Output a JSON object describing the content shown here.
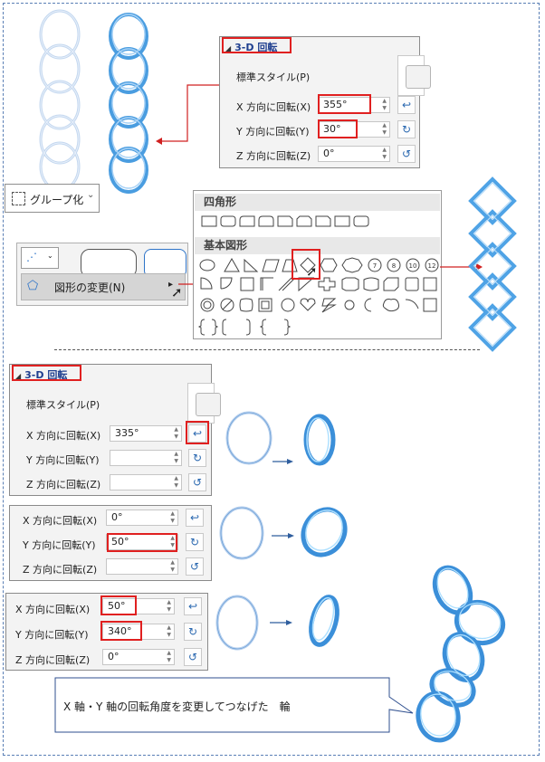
{
  "panel1": {
    "header": "3-D 回転",
    "preset_label": "標準スタイル(P)",
    "x_label": "X 方向に回転(X)",
    "x_value": "355°",
    "y_label": "Y 方向に回転(Y)",
    "y_value": "30°",
    "z_label": "Z 方向に回転(Z)",
    "z_value": "0°"
  },
  "group_button": {
    "label": "グループ化",
    "chevron": "⌄"
  },
  "shapes_gallery": {
    "section1": "四角形",
    "section2": "基本図形",
    "numbers": [
      "7",
      "8",
      "10",
      "12"
    ]
  },
  "menu": {
    "change_shape": "図形の変更(N)"
  },
  "panel2": {
    "header": "3-D 回転",
    "preset_label": "標準スタイル(P)",
    "x_label": "X 方向に回転(X)",
    "x_value": "335°",
    "y_label": "Y 方向に回転(Y)",
    "y_value": "",
    "z_label": "Z 方向に回転(Z)",
    "z_value": ""
  },
  "panel3": {
    "x_label": "X 方向に回転(X)",
    "x_value": "0°",
    "y_label": "Y 方向に回転(Y)",
    "y_value": "50°",
    "z_label": "Z 方向に回転(Z)",
    "z_value": ""
  },
  "panel4": {
    "x_label": "X 方向に回転(X)",
    "x_value": "50°",
    "y_label": "Y 方向に回転(Y)",
    "y_value": "340°",
    "z_label": "Z 方向に回転(Z)",
    "z_value": "0°"
  },
  "callout_text": "X 軸・Y 軸の回転角度を変更してつなげた　輪",
  "colors": {
    "accent": "#2e74c8",
    "red": "#e02020",
    "ring_light": "#bcd3ee",
    "ring_blue": "#3b8fd9"
  }
}
